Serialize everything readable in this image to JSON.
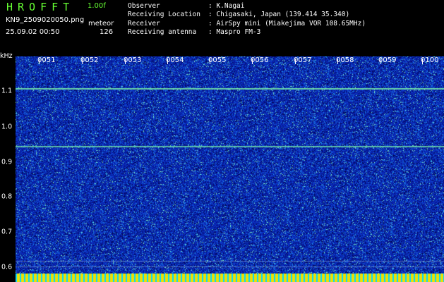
{
  "app": {
    "logo": "HROFFT",
    "version": "1.00f"
  },
  "file": {
    "name": "KN9_2509020050.png",
    "datetime": "25.09.02 00:50"
  },
  "detector": {
    "label": "meteor",
    "count": "126"
  },
  "info": [
    {
      "key": "Observer",
      "value": ": K.Nagai"
    },
    {
      "key": "Receiving Location",
      "value": ": Chigasaki, Japan (139.414 35.340)"
    },
    {
      "key": "Receiver",
      "value": ": AirSpy mini (Miakejima VOR 108.65MHz)"
    },
    {
      "key": "Receiving antenna",
      "value": ": Maspro FM-3"
    }
  ],
  "axis": {
    "y_unit": "kHz",
    "y_ticks": [
      "1.1",
      "1.0",
      "0.9",
      "0.8",
      "0.7",
      "0.6"
    ],
    "x_ticks": [
      "0051",
      "0052",
      "0053",
      "0054",
      "0055",
      "0056",
      "0057",
      "0058",
      "0059",
      "0100"
    ]
  },
  "colors": {
    "noise_base": "#0a2ab8",
    "signal_line": "#7cf0a0",
    "baseline": "#f0e000",
    "accent": "#66ff33"
  }
}
